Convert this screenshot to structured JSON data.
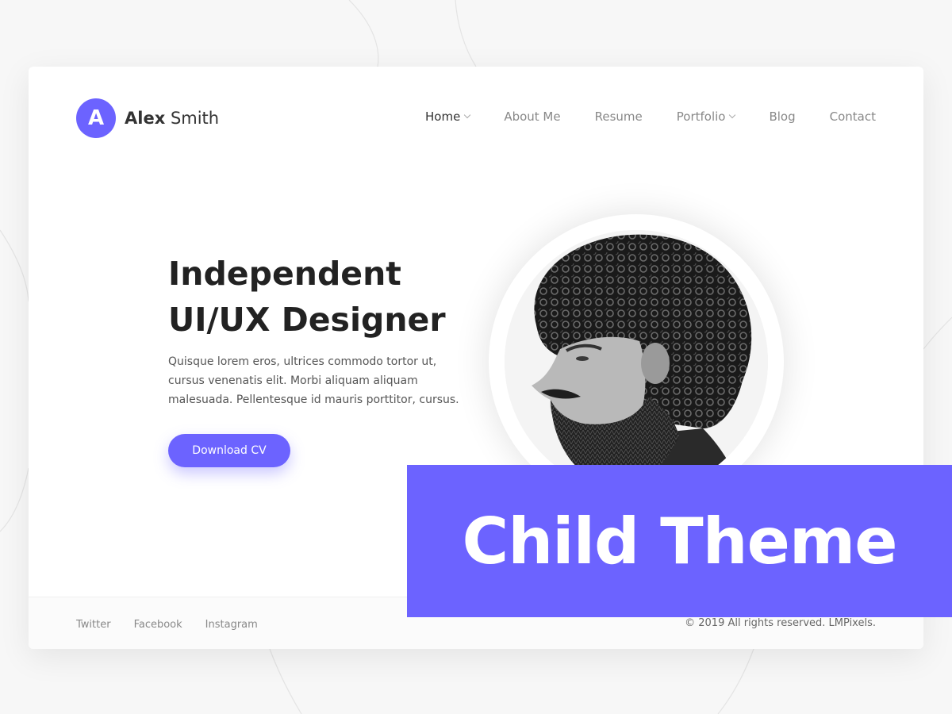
{
  "logo": {
    "symbol": "A",
    "first_name": "Alex",
    "last_name": "Smith"
  },
  "nav": {
    "items": [
      {
        "label": "Home",
        "has_submenu": true,
        "active": true
      },
      {
        "label": "About Me",
        "has_submenu": false,
        "active": false
      },
      {
        "label": "Resume",
        "has_submenu": false,
        "active": false
      },
      {
        "label": "Portfolio",
        "has_submenu": true,
        "active": false
      },
      {
        "label": "Blog",
        "has_submenu": false,
        "active": false
      },
      {
        "label": "Contact",
        "has_submenu": false,
        "active": false
      }
    ]
  },
  "hero": {
    "title_line1": "Independent",
    "title_line2": "UI/UX Designer",
    "description": "Quisque lorem eros, ultrices commodo tortor ut, cursus venenatis elit. Morbi aliquam aliquam malesuada. Pellentesque id mauris porttitor, cursus.",
    "cta_label": "Download CV"
  },
  "footer": {
    "social": [
      "Twitter",
      "Facebook",
      "Instagram"
    ],
    "copyright": "© 2019 All rights reserved. LMPixels."
  },
  "banner": {
    "text": "Child Theme"
  },
  "colors": {
    "accent": "#6c63ff",
    "card": "#ffffff",
    "page": "#f7f7f7"
  }
}
